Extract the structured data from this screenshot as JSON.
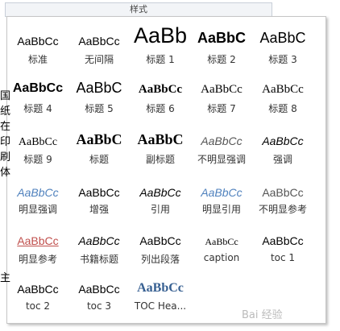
{
  "panel": {
    "title": "样式"
  },
  "background_text": "国纸在印刷体",
  "background_text_lower": "主",
  "styles": [
    {
      "sample": "AaBbCc",
      "label": "标准"
    },
    {
      "sample": "AaBbCc",
      "label": "无间隔"
    },
    {
      "sample": "AaBb",
      "label": "标题 1"
    },
    {
      "sample": "AaBbC",
      "label": "标题 2"
    },
    {
      "sample": "AaBbC",
      "label": "标题 3"
    },
    {
      "sample": "AaBbCc",
      "label": "标题 4"
    },
    {
      "sample": "AaBbC",
      "label": "标题 5"
    },
    {
      "sample": "AaBbCc",
      "label": "标题 6"
    },
    {
      "sample": "AaBbCc",
      "label": "标题 7"
    },
    {
      "sample": "AaBbCc",
      "label": "标题 8"
    },
    {
      "sample": "AaBbCc",
      "label": "标题 9"
    },
    {
      "sample": "AaBbC",
      "label": "标题"
    },
    {
      "sample": "AaBbC",
      "label": "副标题"
    },
    {
      "sample": "AaBbCc",
      "label": "不明显强调"
    },
    {
      "sample": "AaBbCc",
      "label": "强调"
    },
    {
      "sample": "AaBbCc",
      "label": "明显强调"
    },
    {
      "sample": "AaBbCc",
      "label": "增强"
    },
    {
      "sample": "AaBbCc",
      "label": "引用"
    },
    {
      "sample": "AaBbCc",
      "label": "明显引用"
    },
    {
      "sample": "AaBbCc",
      "label": "不明显参考"
    },
    {
      "sample": "AaBbCc",
      "label": "明显参考"
    },
    {
      "sample": "AaBbCc",
      "label": "书籍标题"
    },
    {
      "sample": "AaBbCc",
      "label": "列出段落"
    },
    {
      "sample": "AaBbCc",
      "label": "caption"
    },
    {
      "sample": "AaBbCc",
      "label": "toc 1"
    },
    {
      "sample": "AaBbCc",
      "label": "toc 2"
    },
    {
      "sample": "AaBbCc",
      "label": "toc 3"
    },
    {
      "sample": "AaBbCc",
      "label": "TOC Hea..."
    }
  ],
  "colors": {
    "blue_emphasis": "#4f81bd",
    "red_reference": "#c0504d",
    "heading_blue": "#365f91"
  },
  "watermark": "Bai 经验"
}
